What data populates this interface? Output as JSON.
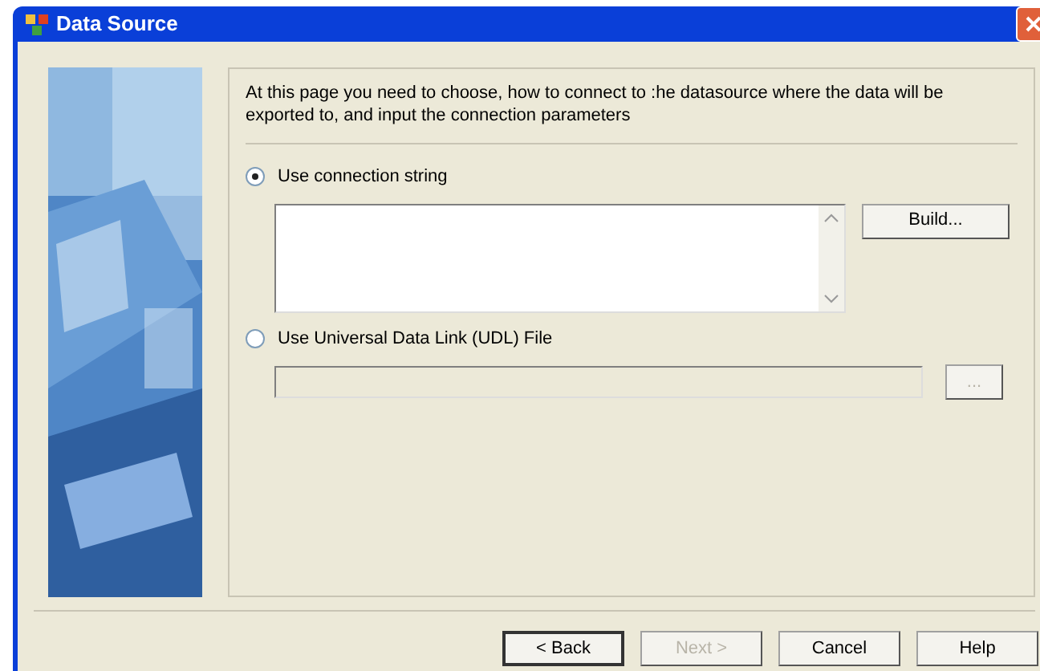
{
  "window": {
    "title": "Data Source"
  },
  "description": "At this page you need to choose, how to connect to :he datasource where the data will be exported to, and input the connection parameters",
  "options": [
    {
      "label": "Use connection string",
      "selected": true
    },
    {
      "label": "Use Universal Data Link (UDL) File",
      "selected": false
    }
  ],
  "build_button": {
    "label": "Build...",
    "disabled": false
  },
  "udl_field": {
    "disabled": true
  },
  "browse_button": {
    "label": "...",
    "disabled": true
  },
  "buttons": [
    {
      "label": "< Back",
      "disabled": false,
      "default": true
    },
    {
      "label": "Next >",
      "disabled": true,
      "default": false
    },
    {
      "label": "Cancel",
      "disabled": false,
      "default": false
    },
    {
      "label": "Help",
      "disabled": false,
      "default": false
    }
  ]
}
